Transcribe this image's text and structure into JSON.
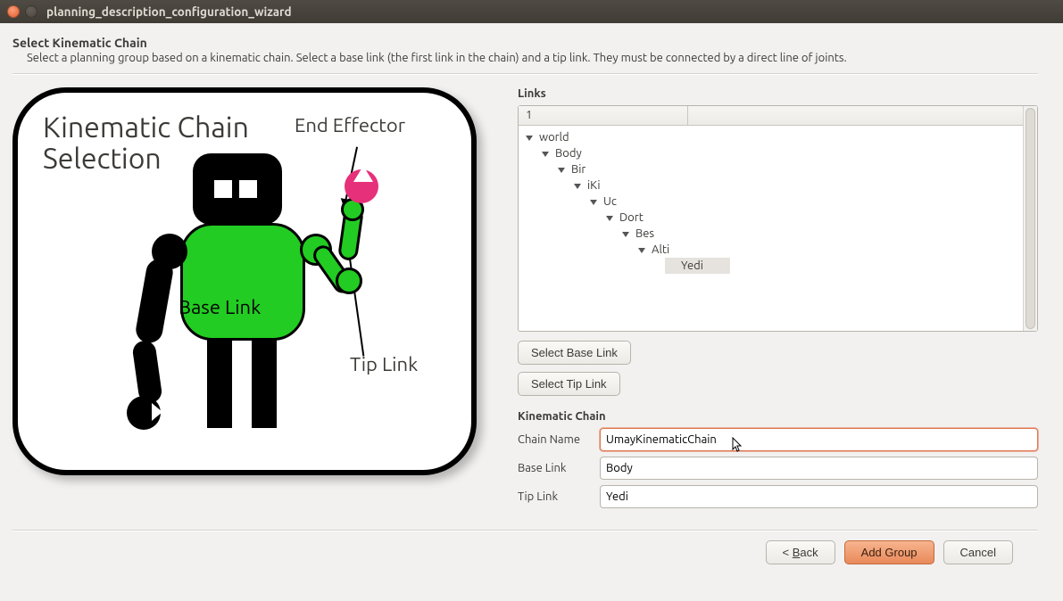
{
  "titlebar": {
    "title": "planning_description_configuration_wizard"
  },
  "header": {
    "title": "Select Kinematic Chain",
    "description": "Select a planning group based on a kinematic chain. Select a base link (the first link in the chain) and a tip link. They must be connected by a direct line of joints."
  },
  "illustration": {
    "title_line1": "Kinematic Chain",
    "title_line2": "Selection",
    "end_effector_label": "End Effector",
    "base_link_label": "Base Link",
    "tip_link_label": "Tip Link"
  },
  "links_panel": {
    "heading": "Links",
    "column_header": "1",
    "tree": {
      "root": "world",
      "n1": "Body",
      "n2": "Bir",
      "n3": "iKi",
      "n4": "Uc",
      "n5": "Dort",
      "n6": "Bes",
      "n7": "Alti",
      "n8": "Yedi",
      "selected": "Yedi"
    },
    "select_base_btn": "Select Base Link",
    "select_tip_btn": "Select Tip Link"
  },
  "chain_form": {
    "heading": "Kinematic Chain",
    "chain_name_label": "Chain Name",
    "chain_name_value": "UmayKinematicChain",
    "base_link_label": "Base Link",
    "base_link_value": "Body",
    "tip_link_label": "Tip Link",
    "tip_link_value": "Yedi"
  },
  "footer": {
    "back_prefix": "< ",
    "back_u": "B",
    "back_rest": "ack",
    "add_group": "Add Group",
    "cancel": "Cancel"
  }
}
